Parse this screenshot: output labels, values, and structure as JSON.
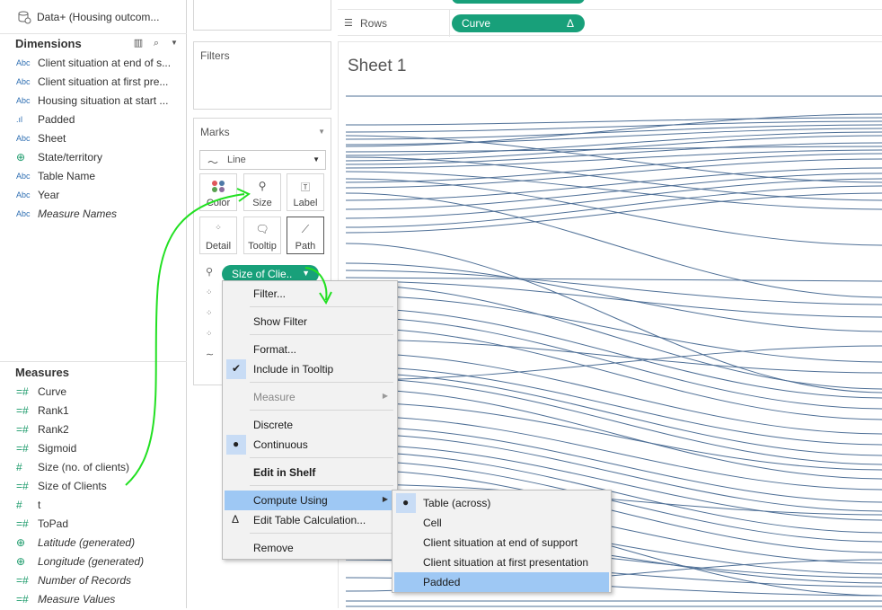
{
  "datasource": {
    "name": "Data+ (Housing outcom..."
  },
  "dimensions": {
    "header": "Dimensions",
    "items": [
      {
        "type": "Abc",
        "label": "Client situation at end of s...",
        "italic": false
      },
      {
        "type": "Abc",
        "label": "Client situation at first pre...",
        "italic": false
      },
      {
        "type": "Abc",
        "label": "Housing situation at start ...",
        "italic": false
      },
      {
        "type": "bin",
        "label": "Padded",
        "italic": false
      },
      {
        "type": "Abc",
        "label": "Sheet",
        "italic": false
      },
      {
        "type": "geo",
        "label": "State/territory",
        "italic": false
      },
      {
        "type": "Abc",
        "label": "Table Name",
        "italic": false
      },
      {
        "type": "Abc",
        "label": "Year",
        "italic": false
      },
      {
        "type": "Abc",
        "label": "Measure Names",
        "italic": true
      }
    ]
  },
  "measures": {
    "header": "Measures",
    "items": [
      {
        "type": "calc",
        "label": "Curve",
        "italic": false
      },
      {
        "type": "calc",
        "label": "Rank1",
        "italic": false
      },
      {
        "type": "calc",
        "label": "Rank2",
        "italic": false
      },
      {
        "type": "calc",
        "label": "Sigmoid",
        "italic": false
      },
      {
        "type": "num",
        "label": "Size (no. of clients)",
        "italic": false
      },
      {
        "type": "calc",
        "label": "Size of Clients",
        "italic": false
      },
      {
        "type": "num",
        "label": "t",
        "italic": false
      },
      {
        "type": "calc",
        "label": "ToPad",
        "italic": false
      },
      {
        "type": "geo",
        "label": "Latitude (generated)",
        "italic": true
      },
      {
        "type": "geo",
        "label": "Longitude (generated)",
        "italic": true
      },
      {
        "type": "calc",
        "label": "Number of Records",
        "italic": true
      },
      {
        "type": "calc",
        "label": "Measure Values",
        "italic": true
      }
    ]
  },
  "filters": {
    "title": "Filters"
  },
  "marks": {
    "title": "Marks",
    "type": "Line",
    "buttons": {
      "color": "Color",
      "size": "Size",
      "label": "Label",
      "detail": "Detail",
      "tooltip": "Tooltip",
      "path": "Path"
    },
    "pill": "Size of Clie.."
  },
  "shelves": {
    "rows_label": "Rows",
    "rows_pill": "Curve",
    "rows_pill_flag": "Δ"
  },
  "sheet": {
    "title": "Sheet 1"
  },
  "context_menu": {
    "items": [
      {
        "label": "Filter...",
        "checked": false
      },
      {
        "label": "Show Filter",
        "checked": false
      },
      {
        "label": "Format...",
        "checked": false
      },
      {
        "label": "Include in Tooltip",
        "checked": true
      },
      {
        "label": "Measure",
        "disabled": true
      },
      {
        "label": "Discrete",
        "checked": false
      },
      {
        "label": "Continuous",
        "checked": true
      },
      {
        "label": "Edit in Shelf",
        "bold": true
      },
      {
        "label": "Compute Using",
        "highlighted": true
      },
      {
        "label": "Edit Table Calculation...",
        "delta": "Δ"
      },
      {
        "label": "Remove"
      }
    ]
  },
  "submenu": {
    "items": [
      {
        "label": "Table (across)",
        "selected": true
      },
      {
        "label": "Cell"
      },
      {
        "label": "Client situation at end of support"
      },
      {
        "label": "Client situation at first presentation"
      },
      {
        "label": "Padded",
        "highlighted": true
      }
    ]
  },
  "colors": {
    "pill_green": "#18a07a",
    "line_blue": "#4e6f96",
    "menu_highlight": "#9ec8f4",
    "annotation_green": "#22e022"
  }
}
